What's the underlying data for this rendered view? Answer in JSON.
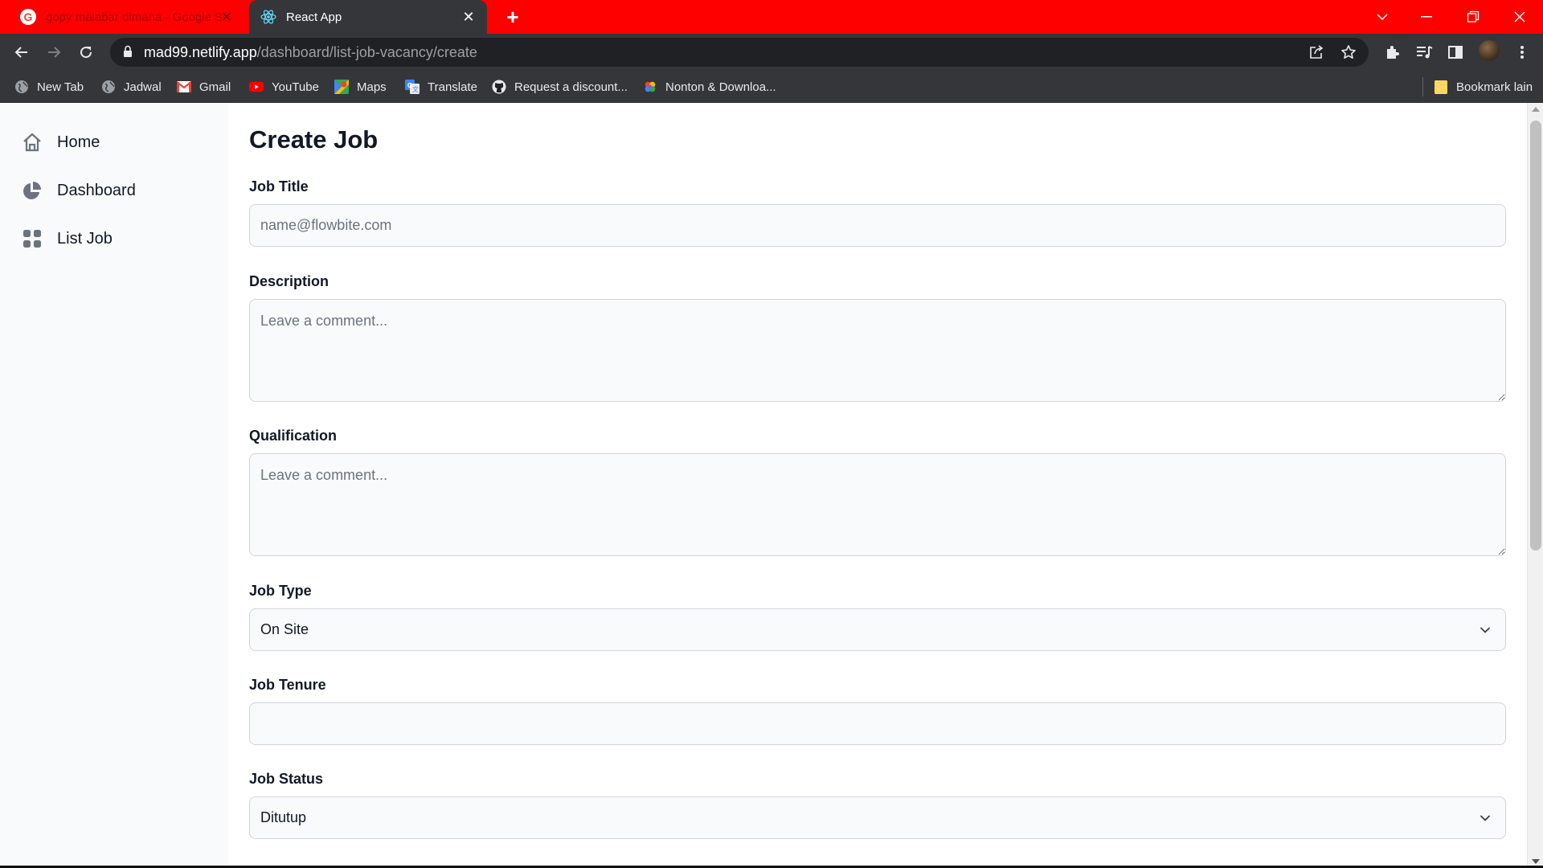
{
  "browser": {
    "tabs": [
      {
        "title": "gopy malabar dimana - Google S",
        "icon": "google-icon",
        "active": false
      },
      {
        "title": "React App",
        "icon": "react-icon",
        "active": true
      }
    ],
    "url_host": "mad99.netlify.app",
    "url_path": "/dashboard/list-job-vacancy/create",
    "bookmarks": [
      {
        "label": "New Tab",
        "icon": "globe-icon"
      },
      {
        "label": "Jadwal",
        "icon": "globe-icon"
      },
      {
        "label": "Gmail",
        "icon": "gmail-icon"
      },
      {
        "label": "YouTube",
        "icon": "youtube-icon"
      },
      {
        "label": "Maps",
        "icon": "maps-icon"
      },
      {
        "label": "Translate",
        "icon": "translate-icon"
      },
      {
        "label": "Request a discount...",
        "icon": "github-icon"
      },
      {
        "label": "Nonton & Downloa...",
        "icon": "colorful-icon"
      }
    ],
    "other_bookmarks": "Bookmark lain",
    "tabbar_color": "#ff0000"
  },
  "sidebar": {
    "items": [
      {
        "label": "Home",
        "icon": "home-icon"
      },
      {
        "label": "Dashboard",
        "icon": "pie-chart-icon"
      },
      {
        "label": "List Job",
        "icon": "grid-icon"
      }
    ]
  },
  "form": {
    "title": "Create Job",
    "job_title": {
      "label": "Job Title",
      "placeholder": "name@flowbite.com",
      "value": ""
    },
    "description": {
      "label": "Description",
      "placeholder": "Leave a comment...",
      "value": ""
    },
    "qualification": {
      "label": "Qualification",
      "placeholder": "Leave a comment...",
      "value": ""
    },
    "job_type": {
      "label": "Job Type",
      "selected": "On Site"
    },
    "job_tenure": {
      "label": "Job Tenure",
      "placeholder": "",
      "value": ""
    },
    "job_status": {
      "label": "Job Status",
      "selected": "Ditutup"
    }
  }
}
